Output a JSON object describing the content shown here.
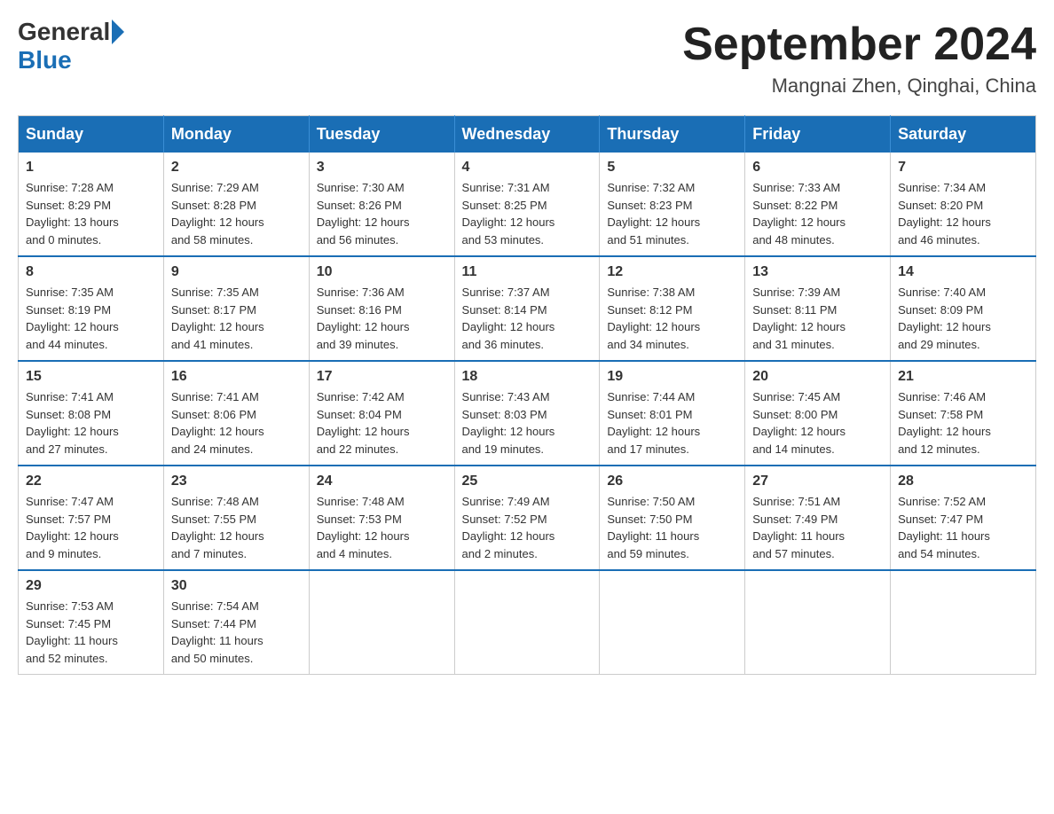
{
  "logo": {
    "general": "General",
    "blue": "Blue"
  },
  "title": "September 2024",
  "subtitle": "Mangnai Zhen, Qinghai, China",
  "days_of_week": [
    "Sunday",
    "Monday",
    "Tuesday",
    "Wednesday",
    "Thursday",
    "Friday",
    "Saturday"
  ],
  "weeks": [
    [
      {
        "day": "1",
        "sunrise": "7:28 AM",
        "sunset": "8:29 PM",
        "daylight": "13 hours and 0 minutes."
      },
      {
        "day": "2",
        "sunrise": "7:29 AM",
        "sunset": "8:28 PM",
        "daylight": "12 hours and 58 minutes."
      },
      {
        "day": "3",
        "sunrise": "7:30 AM",
        "sunset": "8:26 PM",
        "daylight": "12 hours and 56 minutes."
      },
      {
        "day": "4",
        "sunrise": "7:31 AM",
        "sunset": "8:25 PM",
        "daylight": "12 hours and 53 minutes."
      },
      {
        "day": "5",
        "sunrise": "7:32 AM",
        "sunset": "8:23 PM",
        "daylight": "12 hours and 51 minutes."
      },
      {
        "day": "6",
        "sunrise": "7:33 AM",
        "sunset": "8:22 PM",
        "daylight": "12 hours and 48 minutes."
      },
      {
        "day": "7",
        "sunrise": "7:34 AM",
        "sunset": "8:20 PM",
        "daylight": "12 hours and 46 minutes."
      }
    ],
    [
      {
        "day": "8",
        "sunrise": "7:35 AM",
        "sunset": "8:19 PM",
        "daylight": "12 hours and 44 minutes."
      },
      {
        "day": "9",
        "sunrise": "7:35 AM",
        "sunset": "8:17 PM",
        "daylight": "12 hours and 41 minutes."
      },
      {
        "day": "10",
        "sunrise": "7:36 AM",
        "sunset": "8:16 PM",
        "daylight": "12 hours and 39 minutes."
      },
      {
        "day": "11",
        "sunrise": "7:37 AM",
        "sunset": "8:14 PM",
        "daylight": "12 hours and 36 minutes."
      },
      {
        "day": "12",
        "sunrise": "7:38 AM",
        "sunset": "8:12 PM",
        "daylight": "12 hours and 34 minutes."
      },
      {
        "day": "13",
        "sunrise": "7:39 AM",
        "sunset": "8:11 PM",
        "daylight": "12 hours and 31 minutes."
      },
      {
        "day": "14",
        "sunrise": "7:40 AM",
        "sunset": "8:09 PM",
        "daylight": "12 hours and 29 minutes."
      }
    ],
    [
      {
        "day": "15",
        "sunrise": "7:41 AM",
        "sunset": "8:08 PM",
        "daylight": "12 hours and 27 minutes."
      },
      {
        "day": "16",
        "sunrise": "7:41 AM",
        "sunset": "8:06 PM",
        "daylight": "12 hours and 24 minutes."
      },
      {
        "day": "17",
        "sunrise": "7:42 AM",
        "sunset": "8:04 PM",
        "daylight": "12 hours and 22 minutes."
      },
      {
        "day": "18",
        "sunrise": "7:43 AM",
        "sunset": "8:03 PM",
        "daylight": "12 hours and 19 minutes."
      },
      {
        "day": "19",
        "sunrise": "7:44 AM",
        "sunset": "8:01 PM",
        "daylight": "12 hours and 17 minutes."
      },
      {
        "day": "20",
        "sunrise": "7:45 AM",
        "sunset": "8:00 PM",
        "daylight": "12 hours and 14 minutes."
      },
      {
        "day": "21",
        "sunrise": "7:46 AM",
        "sunset": "7:58 PM",
        "daylight": "12 hours and 12 minutes."
      }
    ],
    [
      {
        "day": "22",
        "sunrise": "7:47 AM",
        "sunset": "7:57 PM",
        "daylight": "12 hours and 9 minutes."
      },
      {
        "day": "23",
        "sunrise": "7:48 AM",
        "sunset": "7:55 PM",
        "daylight": "12 hours and 7 minutes."
      },
      {
        "day": "24",
        "sunrise": "7:48 AM",
        "sunset": "7:53 PM",
        "daylight": "12 hours and 4 minutes."
      },
      {
        "day": "25",
        "sunrise": "7:49 AM",
        "sunset": "7:52 PM",
        "daylight": "12 hours and 2 minutes."
      },
      {
        "day": "26",
        "sunrise": "7:50 AM",
        "sunset": "7:50 PM",
        "daylight": "11 hours and 59 minutes."
      },
      {
        "day": "27",
        "sunrise": "7:51 AM",
        "sunset": "7:49 PM",
        "daylight": "11 hours and 57 minutes."
      },
      {
        "day": "28",
        "sunrise": "7:52 AM",
        "sunset": "7:47 PM",
        "daylight": "11 hours and 54 minutes."
      }
    ],
    [
      {
        "day": "29",
        "sunrise": "7:53 AM",
        "sunset": "7:45 PM",
        "daylight": "11 hours and 52 minutes."
      },
      {
        "day": "30",
        "sunrise": "7:54 AM",
        "sunset": "7:44 PM",
        "daylight": "11 hours and 50 minutes."
      },
      null,
      null,
      null,
      null,
      null
    ]
  ],
  "labels": {
    "sunrise": "Sunrise:",
    "sunset": "Sunset:",
    "daylight": "Daylight:"
  }
}
